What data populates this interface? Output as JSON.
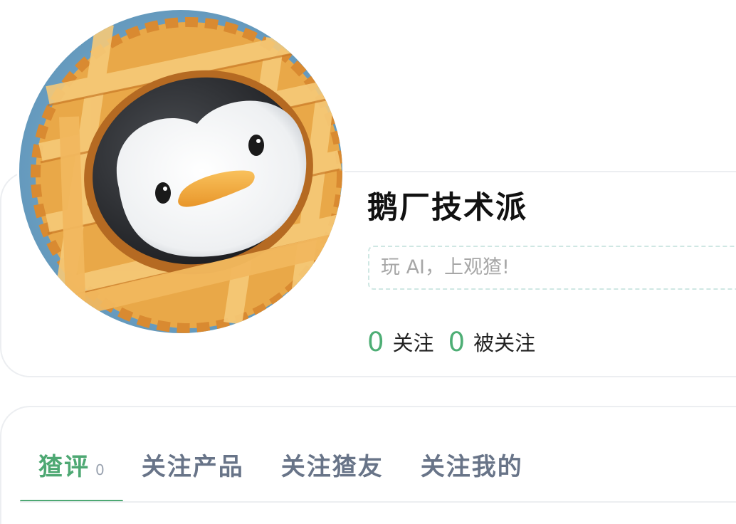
{
  "profile": {
    "username": "鹅厂技术派",
    "bio_placeholder": "玩 AI，上观猹!",
    "stats": [
      {
        "count": "0",
        "label": "关注"
      },
      {
        "count": "0",
        "label": "被关注"
      }
    ]
  },
  "tabs": [
    {
      "label": "猹评",
      "count": "0",
      "active": true
    },
    {
      "label": "关注产品"
    },
    {
      "label": "关注猹友"
    },
    {
      "label": "关注我的"
    }
  ],
  "colors": {
    "accent": "#4ea873",
    "count": "#4eae75",
    "tab_inactive": "#687488",
    "border": "#eceef1"
  },
  "icons": {
    "avatar": "penguin-in-pie-crust"
  }
}
